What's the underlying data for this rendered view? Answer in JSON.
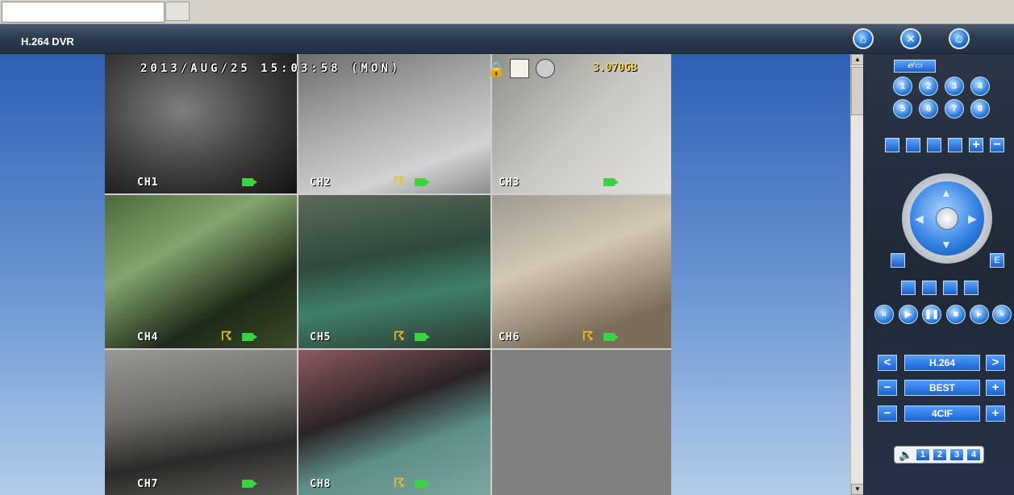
{
  "app": {
    "title": "H.264 DVR"
  },
  "osd": {
    "datetime": "2013/AUG/25  15:03:58  (MON)",
    "hdd": "3.070GB"
  },
  "channels": [
    {
      "label": "CH1",
      "motion": false
    },
    {
      "label": "CH2",
      "motion": true
    },
    {
      "label": "CH3",
      "motion": false
    },
    {
      "label": "CH4",
      "motion": true
    },
    {
      "label": "CH5",
      "motion": true
    },
    {
      "label": "CH6",
      "motion": true
    },
    {
      "label": "CH7",
      "motion": false
    },
    {
      "label": "CH8",
      "motion": true
    }
  ],
  "panel": {
    "channel_buttons": [
      "1",
      "2",
      "3",
      "4",
      "5",
      "6",
      "7",
      "8"
    ],
    "codec": "H.264",
    "quality": "BEST",
    "resolution": "4CIF",
    "e_button": "E",
    "audio_channels": [
      "1",
      "2",
      "3",
      "4"
    ],
    "prev_label": "<",
    "next_label": ">",
    "minus_label": "−",
    "plus_label": "+"
  },
  "colors": {
    "accent": "#1b63d1",
    "panel_bg": "#1f2937",
    "title_bg": "#2d3b4f"
  }
}
